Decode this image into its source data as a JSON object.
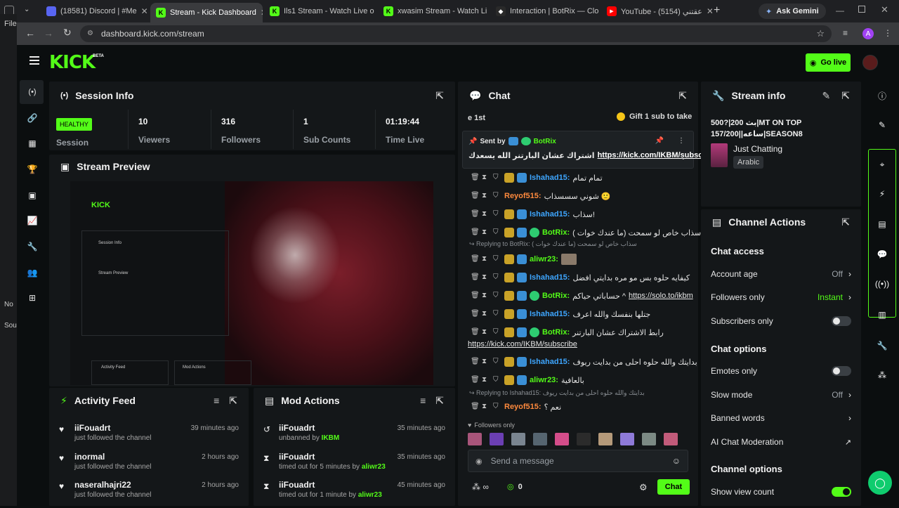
{
  "browser": {
    "tabs": [
      {
        "title": "(18581) Discord | #Me",
        "active": false
      },
      {
        "title": "Stream - Kick Dashboard",
        "active": true
      },
      {
        "title": "Ils1 Stream - Watch Live o",
        "active": false
      },
      {
        "title": "xwasim Stream - Watch Li",
        "active": false
      },
      {
        "title": "Interaction | BotRix — Clo",
        "active": false
      },
      {
        "title": "YouTube - عقتني (5154)",
        "active": false
      }
    ],
    "ask_gemini": "Ask Gemini",
    "url": "dashboard.kick.com/stream",
    "profile_initial": "A",
    "left_strip": [
      "File",
      "No",
      "Sou"
    ]
  },
  "nav": {
    "logo": "KICK",
    "logo_tag": "BETA",
    "go_live": "Go live"
  },
  "session": {
    "title": "Session Info",
    "status": "HEALTHY",
    "status_label": "Session",
    "stats": [
      {
        "value": "10",
        "label": "Viewers"
      },
      {
        "value": "316",
        "label": "Followers"
      },
      {
        "value": "1",
        "label": "Sub Counts"
      },
      {
        "value": "01:19:44",
        "label": "Time Live"
      }
    ]
  },
  "preview": {
    "title": "Stream Preview",
    "mini_logo": "KICK",
    "mini_session": "Session Info",
    "mini_preview": "Stream Preview",
    "mini_activity": "Activity Feed",
    "mini_mod": "Mod Actions"
  },
  "activity": {
    "title": "Activity Feed",
    "items": [
      {
        "name": "iiFouadrt",
        "text": "just followed the channel",
        "time": "39 minutes ago"
      },
      {
        "name": "inormal",
        "text": "just followed the channel",
        "time": "2 hours ago"
      },
      {
        "name": "naseralhajri22",
        "text": "just followed the channel",
        "time": "2 hours ago"
      }
    ]
  },
  "mod": {
    "title": "Mod Actions",
    "items": [
      {
        "name": "iiFouadrt",
        "text": "unbanned by",
        "by": "IKBM",
        "time": "35 minutes ago"
      },
      {
        "name": "iiFouadrt",
        "text": "timed out for 5 minutes by",
        "by": "aliwr23",
        "time": "35 minutes ago"
      },
      {
        "name": "iiFouadrt",
        "text": "timed out for 1 minute by",
        "by": "aliwr23",
        "time": "45 minutes ago"
      }
    ]
  },
  "chat": {
    "title": "Chat",
    "ticker_left": "e 1st",
    "ticker_right": "Gift 1 sub to take",
    "pinned_sent_by": "Sent by",
    "pinned_user": "BotRix",
    "pinned_text": "اشتراك عشان البارتنر الله يسعدك",
    "pinned_link": "https://kick.com/IKBM/subscribe",
    "messages": [
      {
        "user": "Ishahad15",
        "color": "#3ea6ff",
        "text": "تمام تمام",
        "verified": false
      },
      {
        "user": "Reyof515",
        "color": "#ff8a3d",
        "text": "شوني سسسذاب 🙂",
        "verified": false,
        "noSub": true
      },
      {
        "user": "Ishahad15",
        "color": "#3ea6ff",
        "text": "سذاب!",
        "verified": false
      },
      {
        "user": "BotRix",
        "color": "#53fc18",
        "text": "سذاب خاص لو سمحت (ما عندك خوات )",
        "verified": true
      },
      {
        "user": "aliwr23",
        "color": "#53fc18",
        "text": "",
        "verified": false
      },
      {
        "user": "Ishahad15",
        "color": "#3ea6ff",
        "text": "كيفايه حلوه بس مو مره بدايتي افضل",
        "verified": false
      },
      {
        "user": "BotRix",
        "color": "#53fc18",
        "text": "حساباتي حياكم ^",
        "link": "https://solo.to/ikbm",
        "verified": true
      },
      {
        "user": "Ishahad15",
        "color": "#3ea6ff",
        "text": "جتلها بنفسك والله اعرف",
        "verified": false
      },
      {
        "user": "BotRix",
        "color": "#53fc18",
        "text": "رابط الاشتراك عشان البارتنر",
        "verified": true
      },
      {
        "user": "Ishahad15",
        "color": "#3ea6ff",
        "text": "بدايتك والله حلوه احلى من بدايت ريوف",
        "verified": false
      },
      {
        "user": "aliwr23",
        "color": "#53fc18",
        "text": "بالعافية",
        "verified": false
      },
      {
        "user": "Reyof515",
        "color": "#ff8a3d",
        "text": "نعم ؟",
        "verified": false,
        "noSub": true
      }
    ],
    "reply1": "Replying to BotRix: ( سذاب خاص لو سمحت (ما عندك خوات",
    "reply2": "Replying to Ishahad15: بدايتك والله حلوه احلى من بدايت ريوف",
    "botrix_link2": "https://kick.com/IKBM/subscribe",
    "followers_only": "Followers only",
    "input_placeholder": "Send a message",
    "points": "0",
    "chat_button": "Chat"
  },
  "stream_info": {
    "title": "Stream info",
    "stream_title": "بث 200|?500|MT ON TOP",
    "stream_title2": "157/200||ساعه|SEASON8",
    "category": "Just Chatting",
    "language": "Arabic"
  },
  "channel_actions": {
    "title": "Channel Actions",
    "chat_access": "Chat access",
    "account_age": {
      "label": "Account age",
      "value": "Off"
    },
    "followers_only": {
      "label": "Followers only",
      "value": "Instant"
    },
    "subscribers_only": {
      "label": "Subscribers only"
    },
    "chat_options": "Chat options",
    "emotes_only": {
      "label": "Emotes only"
    },
    "slow_mode": {
      "label": "Slow mode",
      "value": "Off"
    },
    "banned_words": {
      "label": "Banned words"
    },
    "ai_moderation": {
      "label": "AI Chat Moderation"
    },
    "channel_options": "Channel options",
    "show_view_count": {
      "label": "Show view count"
    }
  }
}
